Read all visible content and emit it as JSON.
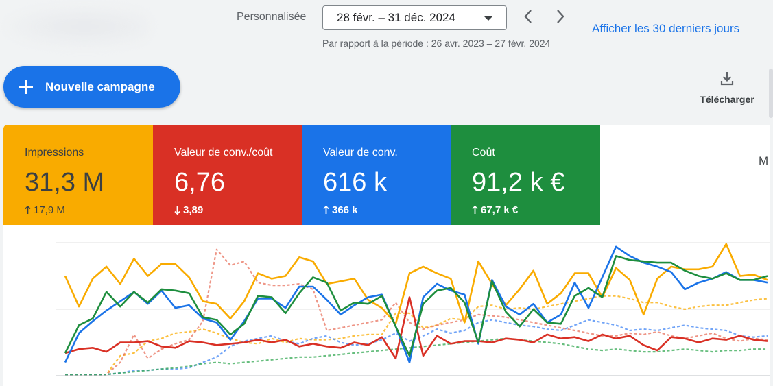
{
  "header": {
    "date_label": "Personnalisée",
    "date_range": "28 févr. – 31 déc. 2024",
    "compare_text": "Par rapport à la période : 26 avr. 2023 – 27 févr. 2024",
    "last_30_link": "Afficher les 30 derniers jours"
  },
  "toolbar": {
    "new_campaign_label": "Nouvelle campagne",
    "download_label": "Télécharger"
  },
  "metrics": [
    {
      "label": "Impressions",
      "value": "31,3 M",
      "delta": "17,9 M",
      "direction": "up",
      "color": "#f9ab00"
    },
    {
      "label": "Valeur de conv./coût",
      "value": "6,76",
      "delta": "3,89",
      "direction": "down",
      "color": "#d93025"
    },
    {
      "label": "Valeur de conv.",
      "value": "616 k",
      "delta": "366 k",
      "direction": "up",
      "color": "#1a73e8"
    },
    {
      "label": "Coût",
      "value": "91,2 k €",
      "delta": "67,7 k €",
      "direction": "up",
      "color": "#1e8e3e"
    }
  ],
  "cut_text": "M",
  "chart_data": {
    "type": "line",
    "x": [
      0,
      1,
      2,
      3,
      4,
      5,
      6,
      7,
      8,
      9,
      10,
      11,
      12,
      13,
      14,
      15,
      16,
      17,
      18,
      19,
      20,
      21,
      22,
      23,
      24,
      25,
      26,
      27,
      28,
      29,
      30,
      31,
      32,
      33,
      34,
      35,
      36,
      37,
      38,
      39,
      40,
      41,
      42,
      43,
      44,
      45,
      46,
      47,
      48,
      49,
      50,
      51
    ],
    "ylim": [
      0,
      100
    ],
    "grid": true,
    "series": [
      {
        "color": "#f9ab00",
        "dashed": false,
        "values": [
          75,
          52,
          73,
          82,
          69,
          88,
          75,
          84,
          84,
          74,
          56,
          54,
          43,
          56,
          77,
          73,
          75,
          89,
          86,
          69,
          71,
          73,
          57,
          51,
          39,
          77,
          82,
          77,
          73,
          40,
          86,
          69,
          53,
          65,
          79,
          54,
          62,
          77,
          77,
          59,
          81,
          72,
          46,
          73,
          82,
          80,
          80,
          82,
          99,
          75,
          76,
          72
        ]
      },
      {
        "color": "#1a73e8",
        "dashed": false,
        "values": [
          10,
          32,
          41,
          49,
          56,
          63,
          54,
          64,
          51,
          53,
          43,
          40,
          27,
          41,
          58,
          58,
          51,
          67,
          67,
          57,
          46,
          53,
          59,
          61,
          37,
          10,
          59,
          69,
          64,
          61,
          24,
          72,
          52,
          46,
          54,
          40,
          46,
          70,
          51,
          74,
          97,
          90,
          85,
          82,
          78,
          65,
          70,
          73,
          78,
          72,
          72,
          70
        ]
      },
      {
        "color": "#1e8e3e",
        "dashed": false,
        "values": [
          17,
          38,
          43,
          63,
          52,
          63,
          55,
          65,
          64,
          62,
          44,
          42,
          31,
          39,
          60,
          59,
          47,
          62,
          74,
          70,
          49,
          55,
          54,
          60,
          37,
          15,
          54,
          64,
          66,
          55,
          25,
          71,
          48,
          37,
          50,
          40,
          39,
          60,
          66,
          59,
          90,
          87,
          86,
          85,
          85,
          79,
          75,
          73,
          77,
          72,
          72,
          75
        ]
      },
      {
        "color": "#d93025",
        "dashed": false,
        "values": [
          17,
          20,
          21,
          18,
          25,
          25,
          26,
          22,
          21,
          26,
          25,
          23,
          24,
          25,
          27,
          25,
          27,
          22,
          24,
          22,
          21,
          25,
          23,
          29,
          13,
          59,
          15,
          30,
          24,
          26,
          26,
          25,
          28,
          27,
          25,
          31,
          28,
          29,
          26,
          31,
          28,
          30,
          23,
          19,
          29,
          28,
          25,
          28,
          27,
          30,
          27,
          26
        ]
      },
      {
        "color": "#f9ab00",
        "dashed": true,
        "values": [
          1,
          1,
          1,
          1,
          15,
          17,
          26,
          28,
          32,
          33,
          35,
          32,
          28,
          25,
          24,
          28,
          25,
          28,
          27,
          27,
          28,
          30,
          31,
          31,
          47,
          47,
          36,
          38,
          43,
          42,
          52,
          53,
          50,
          51,
          50,
          52,
          54,
          56,
          58,
          60,
          60,
          58,
          55,
          55,
          52,
          50,
          52,
          53,
          53,
          55,
          57,
          58
        ]
      },
      {
        "color": "#e8735f",
        "dashed": true,
        "values": [
          1,
          1,
          1,
          1,
          10,
          31,
          13,
          20,
          24,
          27,
          41,
          95,
          83,
          86,
          70,
          68,
          68,
          69,
          65,
          34,
          36,
          38,
          40,
          42,
          55,
          40,
          35,
          38,
          40,
          42,
          46,
          45,
          44,
          42,
          40,
          38,
          36,
          34,
          32,
          30,
          30,
          32,
          31,
          33,
          30,
          28,
          30,
          32,
          28,
          26,
          28,
          27
        ]
      },
      {
        "color": "#4285f4",
        "dashed": true,
        "values": [
          1,
          1,
          1,
          1,
          2,
          4,
          4,
          5,
          5,
          6,
          10,
          14,
          22,
          26,
          28,
          30,
          26,
          24,
          28,
          30,
          25,
          23,
          24,
          27,
          32,
          26,
          30,
          35,
          32,
          34,
          40,
          42,
          40,
          38,
          37,
          35,
          34,
          38,
          42,
          40,
          38,
          34,
          35,
          34,
          36,
          38,
          36,
          35,
          34,
          30,
          29,
          30
        ]
      },
      {
        "color": "#34a853",
        "dashed": true,
        "values": [
          1,
          1,
          1,
          1,
          2,
          3,
          4,
          5,
          6,
          7,
          9,
          10,
          9,
          10,
          11,
          12,
          13,
          14,
          14,
          15,
          16,
          17,
          18,
          19,
          20,
          21,
          22,
          23,
          24,
          25,
          26,
          27,
          28,
          27,
          26,
          25,
          24,
          22,
          20,
          19,
          20,
          19,
          18,
          18,
          19,
          20,
          19,
          18,
          19,
          19,
          20,
          20
        ]
      }
    ]
  }
}
